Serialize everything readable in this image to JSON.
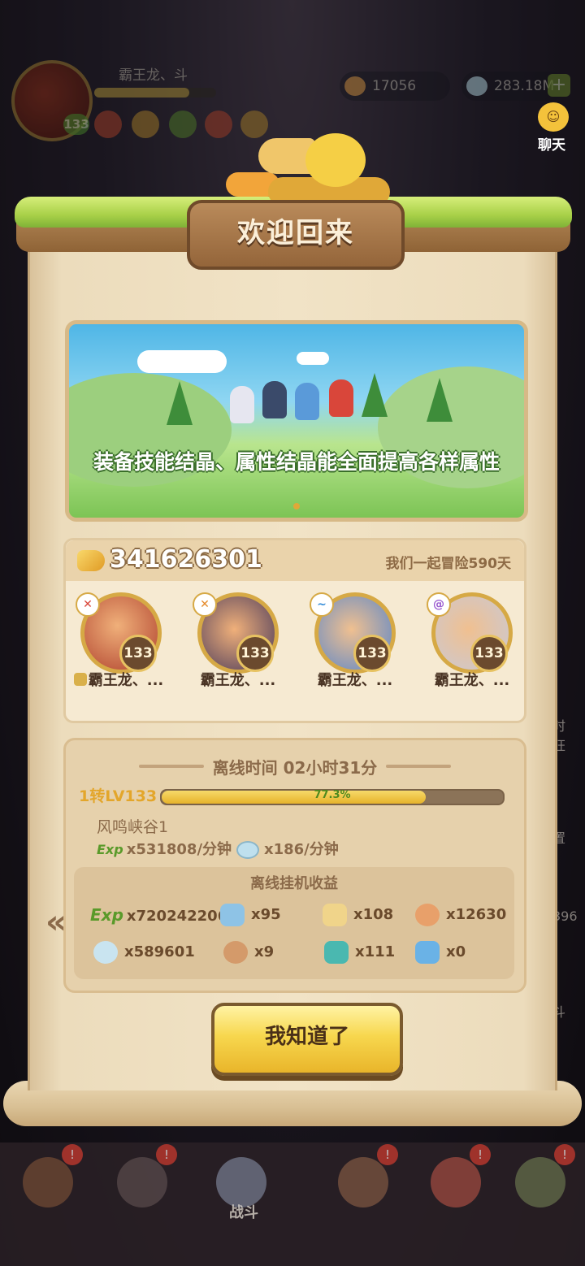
{
  "hud": {
    "player_name": "霸王龙、斗",
    "level": "133",
    "gold": "17056",
    "diamonds": "283.18M",
    "plus": "+",
    "chat_label": "聊天"
  },
  "dialog": {
    "title": "欢迎回来",
    "banner_text": "装备技能结晶、属性结晶能全面提高各样属性",
    "power": "341626301",
    "adventure_days": "我们一起冒险590天",
    "heroes": [
      {
        "name": "霸王龙、...",
        "level": "133",
        "elem_color": "#d9463a"
      },
      {
        "name": "霸王龙、...",
        "level": "133",
        "elem_color": "#e58a2a"
      },
      {
        "name": "霸王龙、...",
        "level": "133",
        "elem_color": "#3a8fd9"
      },
      {
        "name": "霸王龙、...",
        "level": "133",
        "elem_color": "#9a5ad0"
      }
    ],
    "offline_time": "离线时间 02小时31分",
    "rebirth_level": "1转LV133",
    "progress_text": "77.3%",
    "progress_value": 77.3,
    "map_name": "风鸣峡谷1",
    "exp_tag": "Exp",
    "exp_rate": "x531808/分钟",
    "stone_rate": "x186/分钟",
    "rewards_title": "离线挂机收益",
    "rewards": [
      {
        "label": "x720242206",
        "icon": "exp-icon"
      },
      {
        "label": "x95",
        "icon": "gem-shard-icon"
      },
      {
        "label": "x108",
        "icon": "lamp-icon"
      },
      {
        "label": "x12630",
        "icon": "medal-icon"
      },
      {
        "label": "x589601",
        "icon": "stone-icon"
      },
      {
        "label": "x9",
        "icon": "meat-icon"
      },
      {
        "label": "x111",
        "icon": "teal-crystal-icon"
      },
      {
        "label": "x0",
        "icon": "blue-crystal-icon"
      }
    ],
    "prev_arrow": "«",
    "confirm_label": "我知道了"
  },
  "bottom_nav": {
    "battle_label": "战斗"
  },
  "side": {
    "t1": "时",
    "t2": "狂",
    "t3": "置",
    "t4": "396",
    "t5": "斗"
  },
  "colors": {
    "accent_gold": "#f7d74e",
    "parchment": "#f1e3c6",
    "progress_fill": "#e7b32a",
    "exp_green": "#5a9a2a"
  }
}
